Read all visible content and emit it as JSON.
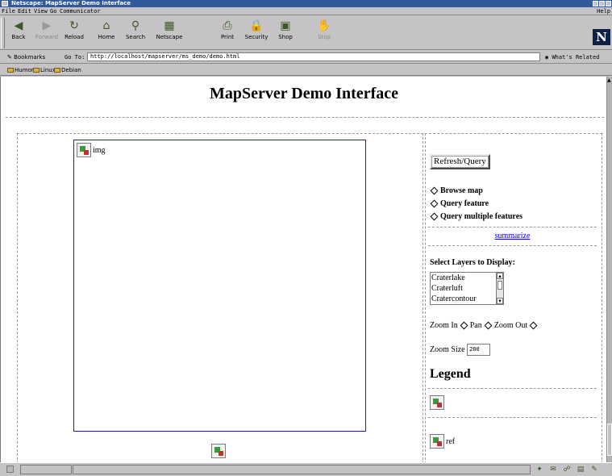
{
  "window": {
    "title": "Netscape: MapServer Demo Interface"
  },
  "menu": {
    "items": [
      "File",
      "Edit",
      "View",
      "Go",
      "Communicator"
    ],
    "help": "Help"
  },
  "toolbar": {
    "buttons": [
      {
        "label": "Back",
        "icon": "back-arrow-icon",
        "glyph": "◀"
      },
      {
        "label": "Forward",
        "icon": "forward-arrow-icon",
        "glyph": "▶"
      },
      {
        "label": "Reload",
        "icon": "reload-icon",
        "glyph": "↻"
      },
      {
        "label": "Home",
        "icon": "home-icon",
        "glyph": "⌂"
      },
      {
        "label": "Search",
        "icon": "search-icon",
        "glyph": "⚲"
      },
      {
        "label": "Netscape",
        "icon": "netscape-icon",
        "glyph": "▦"
      },
      {
        "label": "Print",
        "icon": "print-icon",
        "glyph": "⎙"
      },
      {
        "label": "Security",
        "icon": "security-lock-icon",
        "glyph": "🔒"
      },
      {
        "label": "Shop",
        "icon": "shop-icon",
        "glyph": "▣"
      },
      {
        "label": "Stop",
        "icon": "stop-icon",
        "glyph": "✋"
      }
    ],
    "logo": "N"
  },
  "location": {
    "bookmarks_label": "Bookmarks",
    "goto_label": "Go To:",
    "url": "http://localhost/mapserver/ms_demo/demo.html",
    "related_label": "What's Related"
  },
  "personal_toolbar": {
    "items": [
      "Humor",
      "Linux",
      "Debian"
    ]
  },
  "page": {
    "title": "MapServer Demo Interface",
    "map_img_alt": "img",
    "refresh_button": "Refresh/Query",
    "modes": [
      "Browse map",
      "Query feature",
      "Query multiple features"
    ],
    "summarize_link": "summarize",
    "layers_heading": "Select Layers to Display:",
    "layers": [
      "Craterlake",
      "Craterluft",
      "Cratercontour"
    ],
    "zoom_in": "Zoom In",
    "pan": "Pan",
    "zoom_out": "Zoom Out",
    "zoom_size_label": "Zoom Size",
    "zoom_size_value": "200",
    "legend_heading": "Legend",
    "ref_img_alt": "ref"
  },
  "colors": {
    "titlebar": "#315a9c",
    "link": "#0000ee",
    "map_border": "#2020b0"
  }
}
